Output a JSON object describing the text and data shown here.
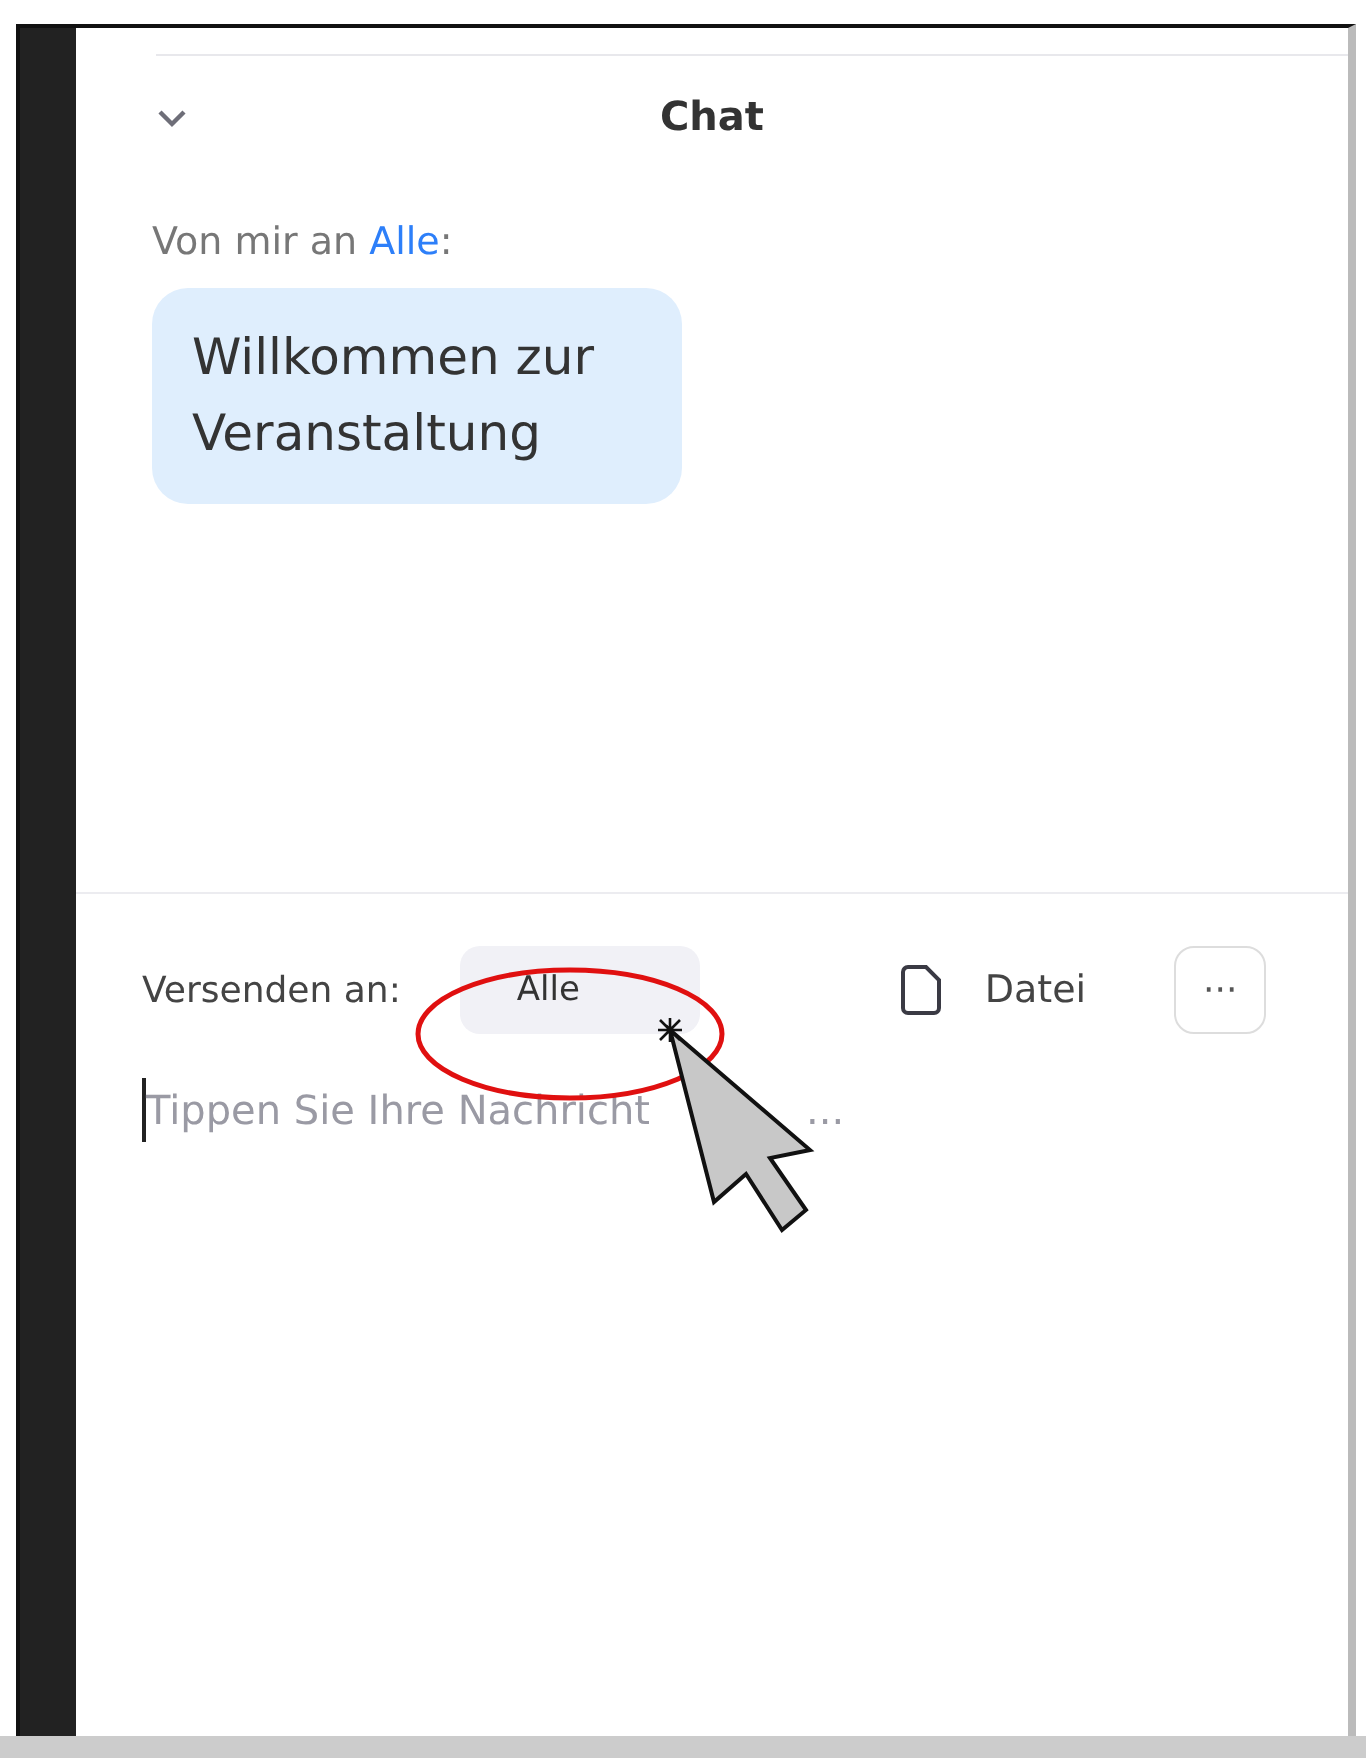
{
  "chat": {
    "title": "Chat",
    "message": {
      "prefix": "Von mir an",
      "recipient": "Alle",
      "suffix": ":",
      "text": "Willkommen zur Veranstaltung"
    },
    "composer": {
      "send_to_label": "Versenden an:",
      "recipient_button": "Alle",
      "file_button": "Datei",
      "more_button": "···",
      "placeholder": "Tippen Sie Ihre Nachricht",
      "placeholder_tail": "..."
    }
  }
}
